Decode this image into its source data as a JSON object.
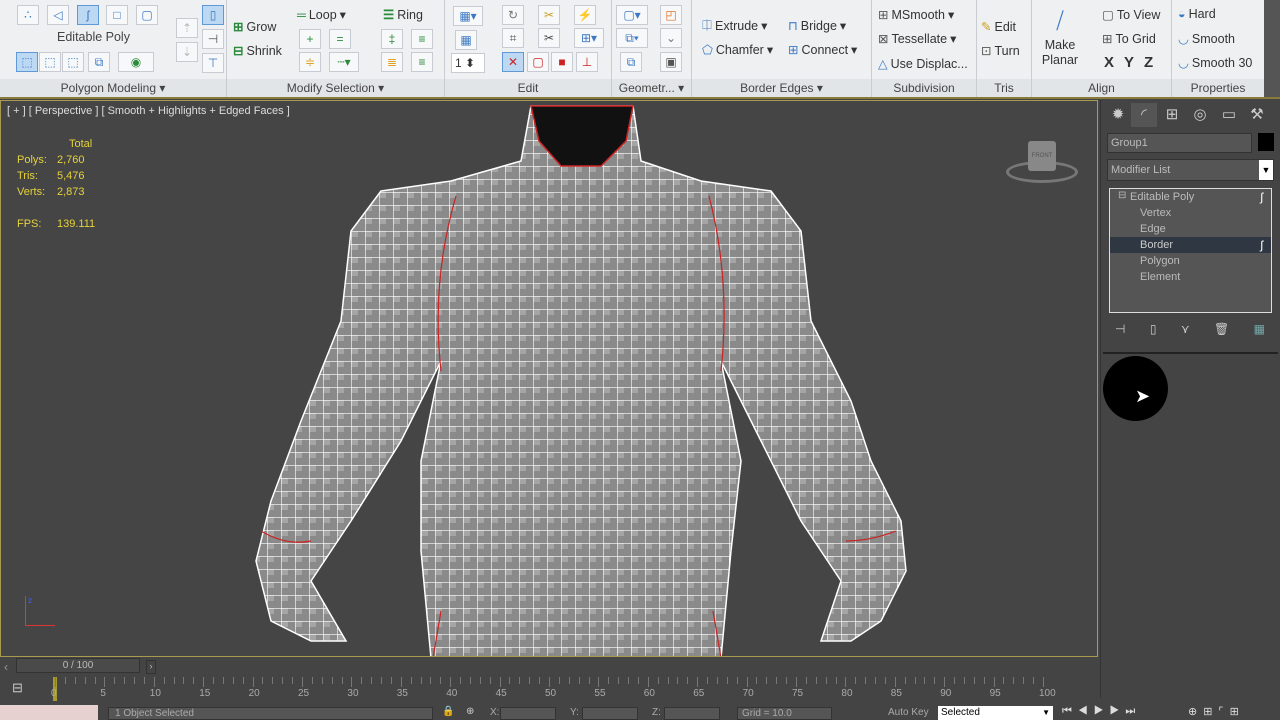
{
  "ribbon": {
    "polygon_modeling": {
      "object": "Editable Poly",
      "label": "Polygon Modeling"
    },
    "modify_selection": {
      "grow": "Grow",
      "shrink": "Shrink",
      "loop": "Loop",
      "ring": "Ring",
      "label": "Modify Selection"
    },
    "edit": {
      "label": "Edit",
      "spinner": "1"
    },
    "geometry": {
      "label": "Geometr..."
    },
    "border_edges": {
      "extrude": "Extrude",
      "bridge": "Bridge",
      "chamfer": "Chamfer",
      "connect": "Connect",
      "label": "Border Edges"
    },
    "subdivision": {
      "msmooth": "MSmooth",
      "tessellate": "Tessellate",
      "use_displace": "Use Displac...",
      "label": "Subdivision"
    },
    "tris": {
      "edit": "Edit",
      "turn": "Turn",
      "label": "Tris"
    },
    "align": {
      "make_planar_1": "Make",
      "make_planar_2": "Planar",
      "to_view": "To View",
      "to_grid": "To Grid",
      "x": "X",
      "y": "Y",
      "z": "Z",
      "label": "Align"
    },
    "properties": {
      "hard": "Hard",
      "smooth": "Smooth",
      "smooth30": "Smooth 30",
      "label": "Properties"
    }
  },
  "viewport": {
    "label": "[ + ] [ Perspective ] [ Smooth + Highlights + Edged Faces ]",
    "stats": {
      "header": "Total",
      "polys_label": "Polys:",
      "polys": "2,760",
      "tris_label": "Tris:",
      "tris": "5,476",
      "verts_label": "Verts:",
      "verts": "2,873",
      "fps_label": "FPS:",
      "fps": "139.111"
    },
    "viewcube": "FRONT"
  },
  "command_panel": {
    "object_name": "Group1",
    "modifier_list": "Modifier List",
    "stack": [
      "Editable Poly",
      "Vertex",
      "Edge",
      "Border",
      "Polygon",
      "Element"
    ],
    "selected": "Border"
  },
  "timeline": {
    "frame": "0 / 100",
    "ticks": [
      "0",
      "5",
      "10",
      "15",
      "20",
      "25",
      "30",
      "35",
      "40",
      "45",
      "50",
      "55",
      "60",
      "65",
      "70",
      "75",
      "80",
      "85",
      "90",
      "95",
      "100"
    ]
  },
  "status": {
    "selection": "1 Object Selected",
    "x": "X:",
    "y": "Y:",
    "z": "Z:",
    "grid": "Grid = 10.0",
    "autokey": "Auto Key",
    "key_mode": "Selected"
  },
  "colors": {
    "accent": "#3b79c2",
    "stats": "#e6d23a",
    "border_sel": "#cc2222"
  }
}
